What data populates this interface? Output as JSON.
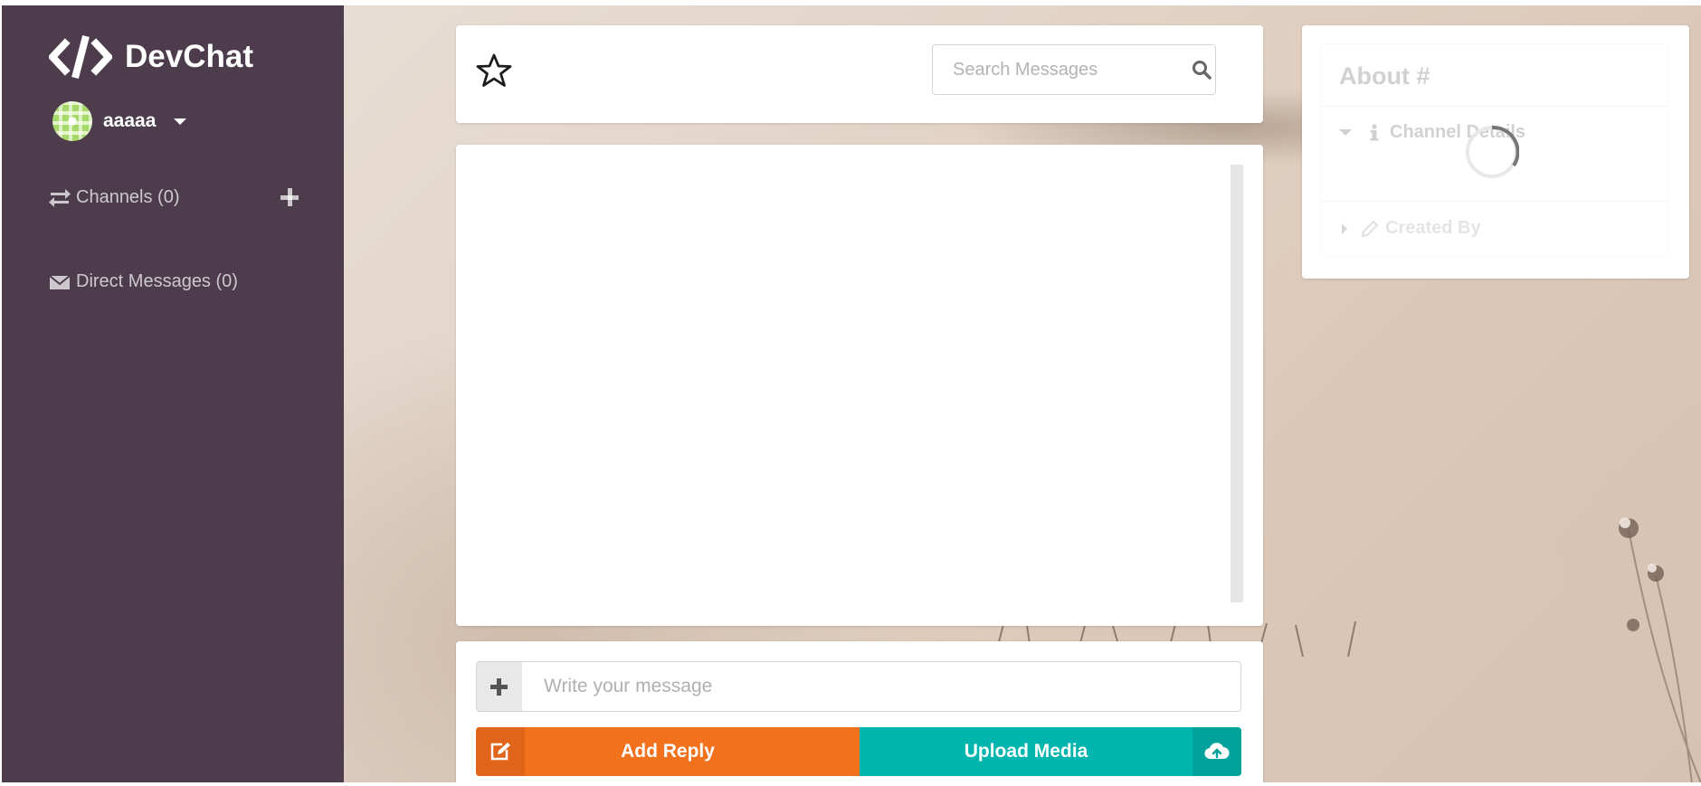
{
  "app": {
    "name": "DevChat",
    "icon": "code-icon"
  },
  "user": {
    "name": "aaaaa",
    "avatar_color": "#a6d96a"
  },
  "sidebar": {
    "background": "#4c3c4c",
    "channels_label": "Channels (0)",
    "direct_messages_label": "Direct Messages (0)"
  },
  "header": {
    "star_icon": "star-outline-icon",
    "search": {
      "placeholder": "Search Messages",
      "value": "",
      "icon": "search-icon"
    }
  },
  "messages": {
    "items": []
  },
  "compose": {
    "placeholder": "Write your message",
    "value": "",
    "add_reply_label": "Add Reply",
    "upload_media_label": "Upload Media",
    "add_reply_color": "#f2711c",
    "upload_media_color": "#00b5ad"
  },
  "about": {
    "title": "About #",
    "sections": [
      {
        "label": "Channel Details",
        "icon": "info-icon",
        "expanded": true
      },
      {
        "label": "Created By",
        "icon": "pencil-icon",
        "expanded": false
      }
    ],
    "loading": true
  }
}
